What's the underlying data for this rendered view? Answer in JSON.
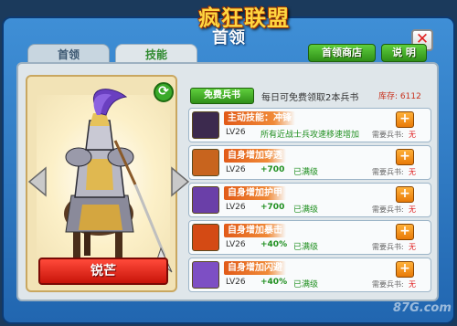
{
  "game_logo": "疯狂联盟",
  "window": {
    "title": "首领",
    "close_icon": "close-x-icon"
  },
  "tabs": [
    {
      "label": "首领",
      "active": false
    },
    {
      "label": "技能",
      "active": true
    }
  ],
  "buttons": {
    "shop": "首领商店",
    "help": "说 明"
  },
  "hero": {
    "name": "锐芒"
  },
  "skill_book": {
    "free_button": "免费兵书",
    "free_text": "每日可免费领取2本兵书",
    "stock_text": "库存: 6112"
  },
  "skills": [
    {
      "name": "主动技能：冲锋",
      "level": "LV26",
      "desc": "所有近战士兵攻速移速增加",
      "need_label": "需要兵书:",
      "need_value": "无",
      "icon_color": "#3c2a4e"
    },
    {
      "name": "自身增加穿透",
      "level": "LV26",
      "bonus": "+700",
      "status": "已满级",
      "need_label": "需要兵书:",
      "need_value": "无",
      "icon_color": "#c8641e"
    },
    {
      "name": "自身增加护甲",
      "level": "LV26",
      "bonus": "+700",
      "status": "已满级",
      "need_label": "需要兵书:",
      "need_value": "无",
      "icon_color": "#6a3fa8"
    },
    {
      "name": "自身增加暴击",
      "level": "LV26",
      "bonus": "+40%",
      "status": "已满级",
      "need_label": "需要兵书:",
      "need_value": "无",
      "icon_color": "#d44a14"
    },
    {
      "name": "自身增加闪避",
      "level": "LV26",
      "bonus": "+40%",
      "status": "已满级",
      "need_label": "需要兵书:",
      "need_value": "无",
      "icon_color": "#7d4fc4"
    }
  ],
  "watermark": "87G.com",
  "colors": {
    "frame_blue": "#2f7fc8",
    "accent_green": "#3aa82a",
    "accent_orange": "#f08a38",
    "ribbon_red": "#d0180c"
  }
}
